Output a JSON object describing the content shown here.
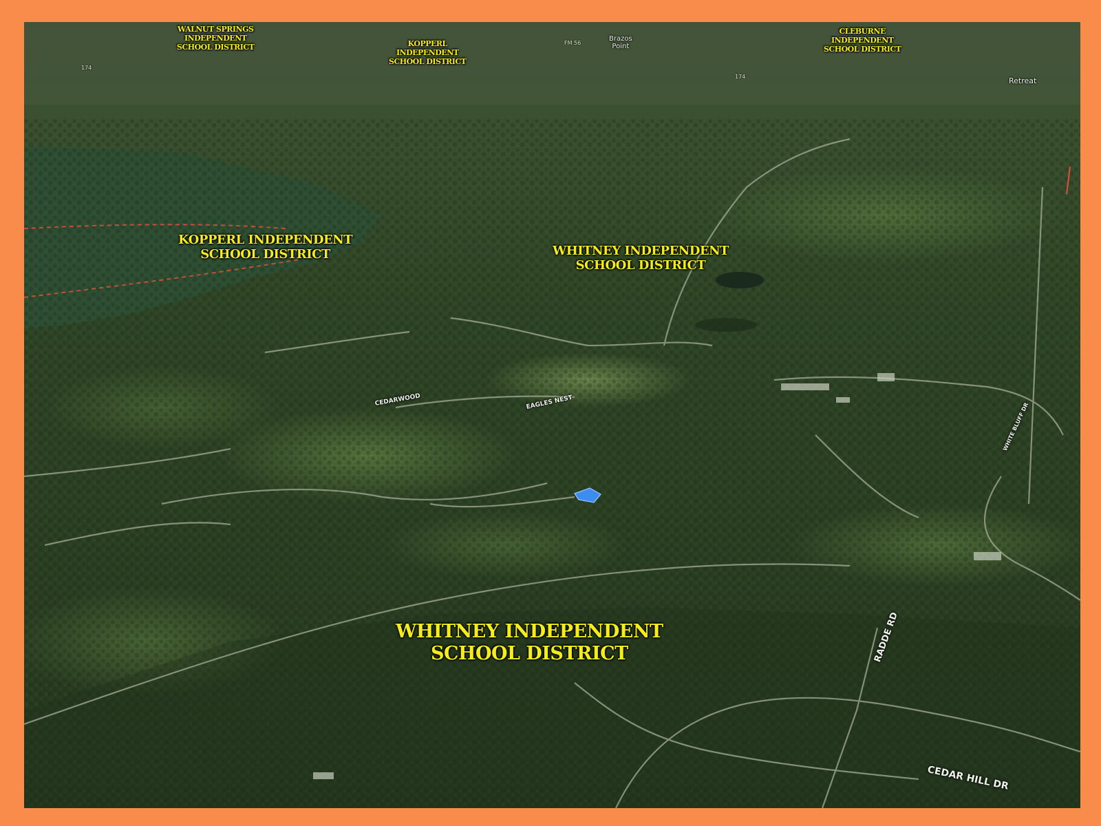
{
  "map": {
    "colors": {
      "frame": "#fa8c4b",
      "label_text": "#f5ec1c",
      "road_text": "#eef0ea",
      "parcel_highlight": "#3d8df0",
      "boundary_line": "#e0503a"
    },
    "district_labels": [
      {
        "id": "walnut-springs",
        "lines": [
          "WALNUT SPRINGS",
          "INDEPENDENT",
          "SCHOOL DISTRICT"
        ]
      },
      {
        "id": "kopperl-top",
        "lines": [
          "KOPPERL",
          "INDEPENDENT",
          "SCHOOL DISTRICT"
        ]
      },
      {
        "id": "cleburne",
        "lines": [
          "CLEBURNE",
          "INDEPENDENT",
          "SCHOOL DISTRICT"
        ]
      },
      {
        "id": "kopperl-mid",
        "lines": [
          "KOPPERL INDEPENDENT",
          "SCHOOL DISTRICT"
        ]
      },
      {
        "id": "whitney-mid",
        "lines": [
          "WHITNEY INDEPENDENT",
          "SCHOOL DISTRICT"
        ]
      },
      {
        "id": "whitney-main",
        "lines": [
          "WHITNEY INDEPENDENT",
          "SCHOOL DISTRICT"
        ]
      }
    ],
    "places": {
      "brazos_point": [
        "Brazos",
        "Point"
      ],
      "retreat": "Retreat",
      "fm56": "FM 56",
      "hwy174a": "174",
      "hwy174b": "174"
    },
    "roads": {
      "cedarwood": "CEDARWOOD",
      "eagles_nest": "EAGLES NEST",
      "radde_rd": "RADDE RD",
      "cedar_hill_dr": "CEDAR HILL DR",
      "white_bluff": "WHITE BLUFF DR"
    }
  }
}
